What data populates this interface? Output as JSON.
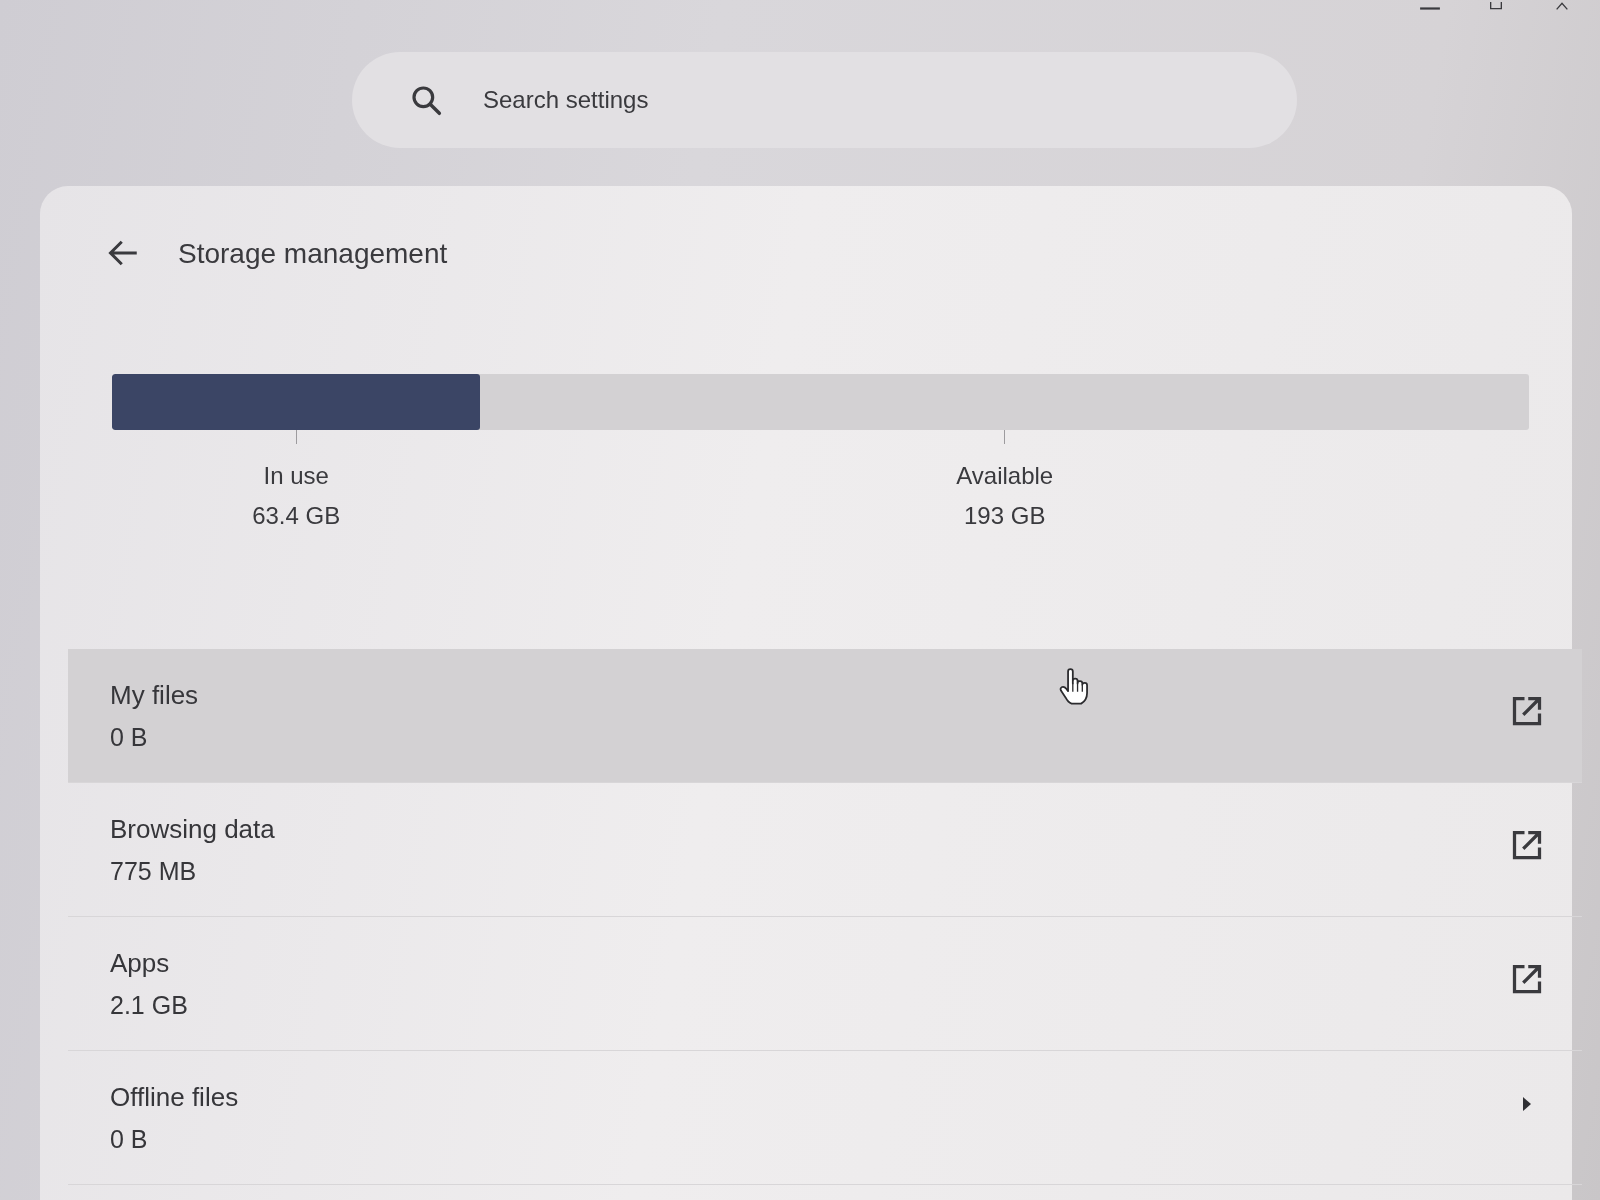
{
  "search": {
    "placeholder": "Search settings"
  },
  "page": {
    "title": "Storage management"
  },
  "storage_bar": {
    "level": 0.26,
    "in_use": {
      "label": "In use",
      "value": "63.4 GB"
    },
    "available": {
      "label": "Available",
      "value": "193 GB"
    }
  },
  "items": [
    {
      "label": "My files",
      "size": "0 B",
      "kind": "external",
      "hovered": true
    },
    {
      "label": "Browsing data",
      "size": "775 MB",
      "kind": "external",
      "hovered": false
    },
    {
      "label": "Apps",
      "size": "2.1 GB",
      "kind": "external",
      "hovered": false
    },
    {
      "label": "Offline files",
      "size": "0 B",
      "kind": "subpage",
      "hovered": false
    }
  ]
}
